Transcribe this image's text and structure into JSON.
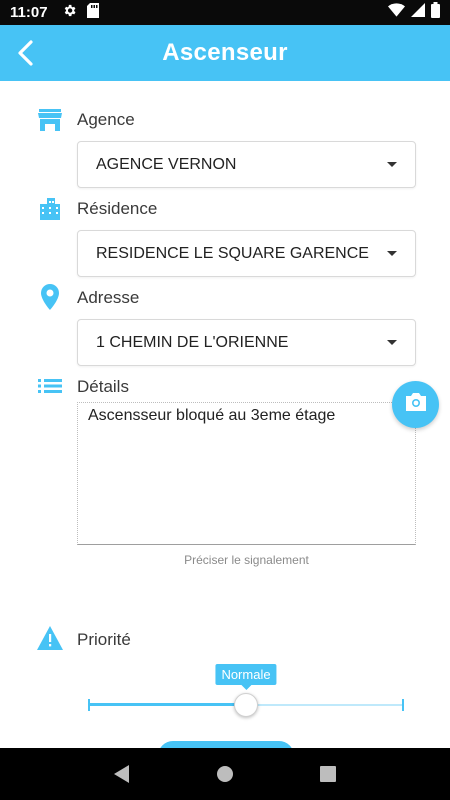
{
  "status_bar": {
    "time": "11:07",
    "icons": [
      "settings-gear-icon",
      "sd-card-icon",
      "wifi-icon",
      "cell-signal-icon",
      "battery-icon"
    ]
  },
  "app_bar": {
    "title": "Ascenseur",
    "back_icon": "chevron-left-icon",
    "color": "#47c3f5"
  },
  "form": {
    "agence": {
      "label": "Agence",
      "icon": "store-icon",
      "value": "AGENCE VERNON"
    },
    "residence": {
      "label": "Résidence",
      "icon": "building-icon",
      "value": "RESIDENCE LE SQUARE GARENCE"
    },
    "adresse": {
      "label": "Adresse",
      "icon": "location-pin-icon",
      "value": "1 CHEMIN DE L'ORIENNE"
    },
    "details": {
      "label": "Détails",
      "icon": "list-icon",
      "value": "Ascensseur bloqué au 3eme étage",
      "hint": "Préciser le signalement"
    },
    "camera_button_icon": "camera-icon",
    "priorite": {
      "label": "Priorité",
      "icon": "warning-icon",
      "value_label": "Normale",
      "level": 0.5
    }
  },
  "nav_bar": {
    "icons": [
      "back-triangle-icon",
      "home-circle-icon",
      "recents-square-icon"
    ]
  }
}
